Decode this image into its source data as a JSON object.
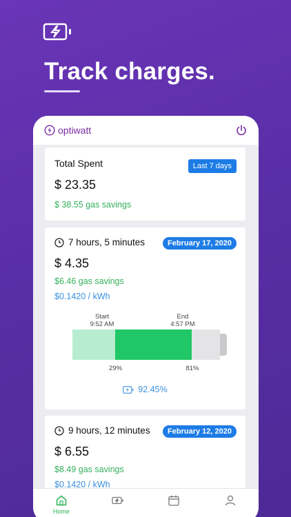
{
  "hero": {
    "title": "Track charges."
  },
  "header": {
    "brand": "optiwatt"
  },
  "total": {
    "label": "Total Spent",
    "range_button": "Last 7 days",
    "amount": "$ 23.35",
    "savings": "$ 38.55 gas savings"
  },
  "sessions": [
    {
      "duration": "7 hours, 5 minutes",
      "date": "February 17, 2020",
      "amount": "$ 4.35",
      "savings": "$6.46 gas savings",
      "rate": "$0.1420 / kWh",
      "start_label": "Start",
      "start_time": "9:52 AM",
      "end_label": "End",
      "end_time": "4:57 PM",
      "start_pct": "29%",
      "end_pct": "81%",
      "start_fraction": 0.29,
      "end_fraction": 0.81,
      "efficiency": "92.45%"
    },
    {
      "duration": "9 hours, 12 minutes",
      "date": "February 12, 2020",
      "amount": "$ 6.55",
      "savings": "$8.49 gas savings",
      "rate": "$0.1420 / kWh"
    }
  ],
  "tabs": [
    {
      "label": "Home",
      "icon": "home-icon"
    },
    {
      "label": "",
      "icon": "battery-charging-icon"
    },
    {
      "label": "",
      "icon": "calendar-icon"
    },
    {
      "label": "",
      "icon": "user-icon"
    }
  ],
  "colors": {
    "accent_blue": "#1d7ce6",
    "savings_green": "#34b05b",
    "charge_green": "#1fc766",
    "brand_purple": "#7a2ba3"
  }
}
